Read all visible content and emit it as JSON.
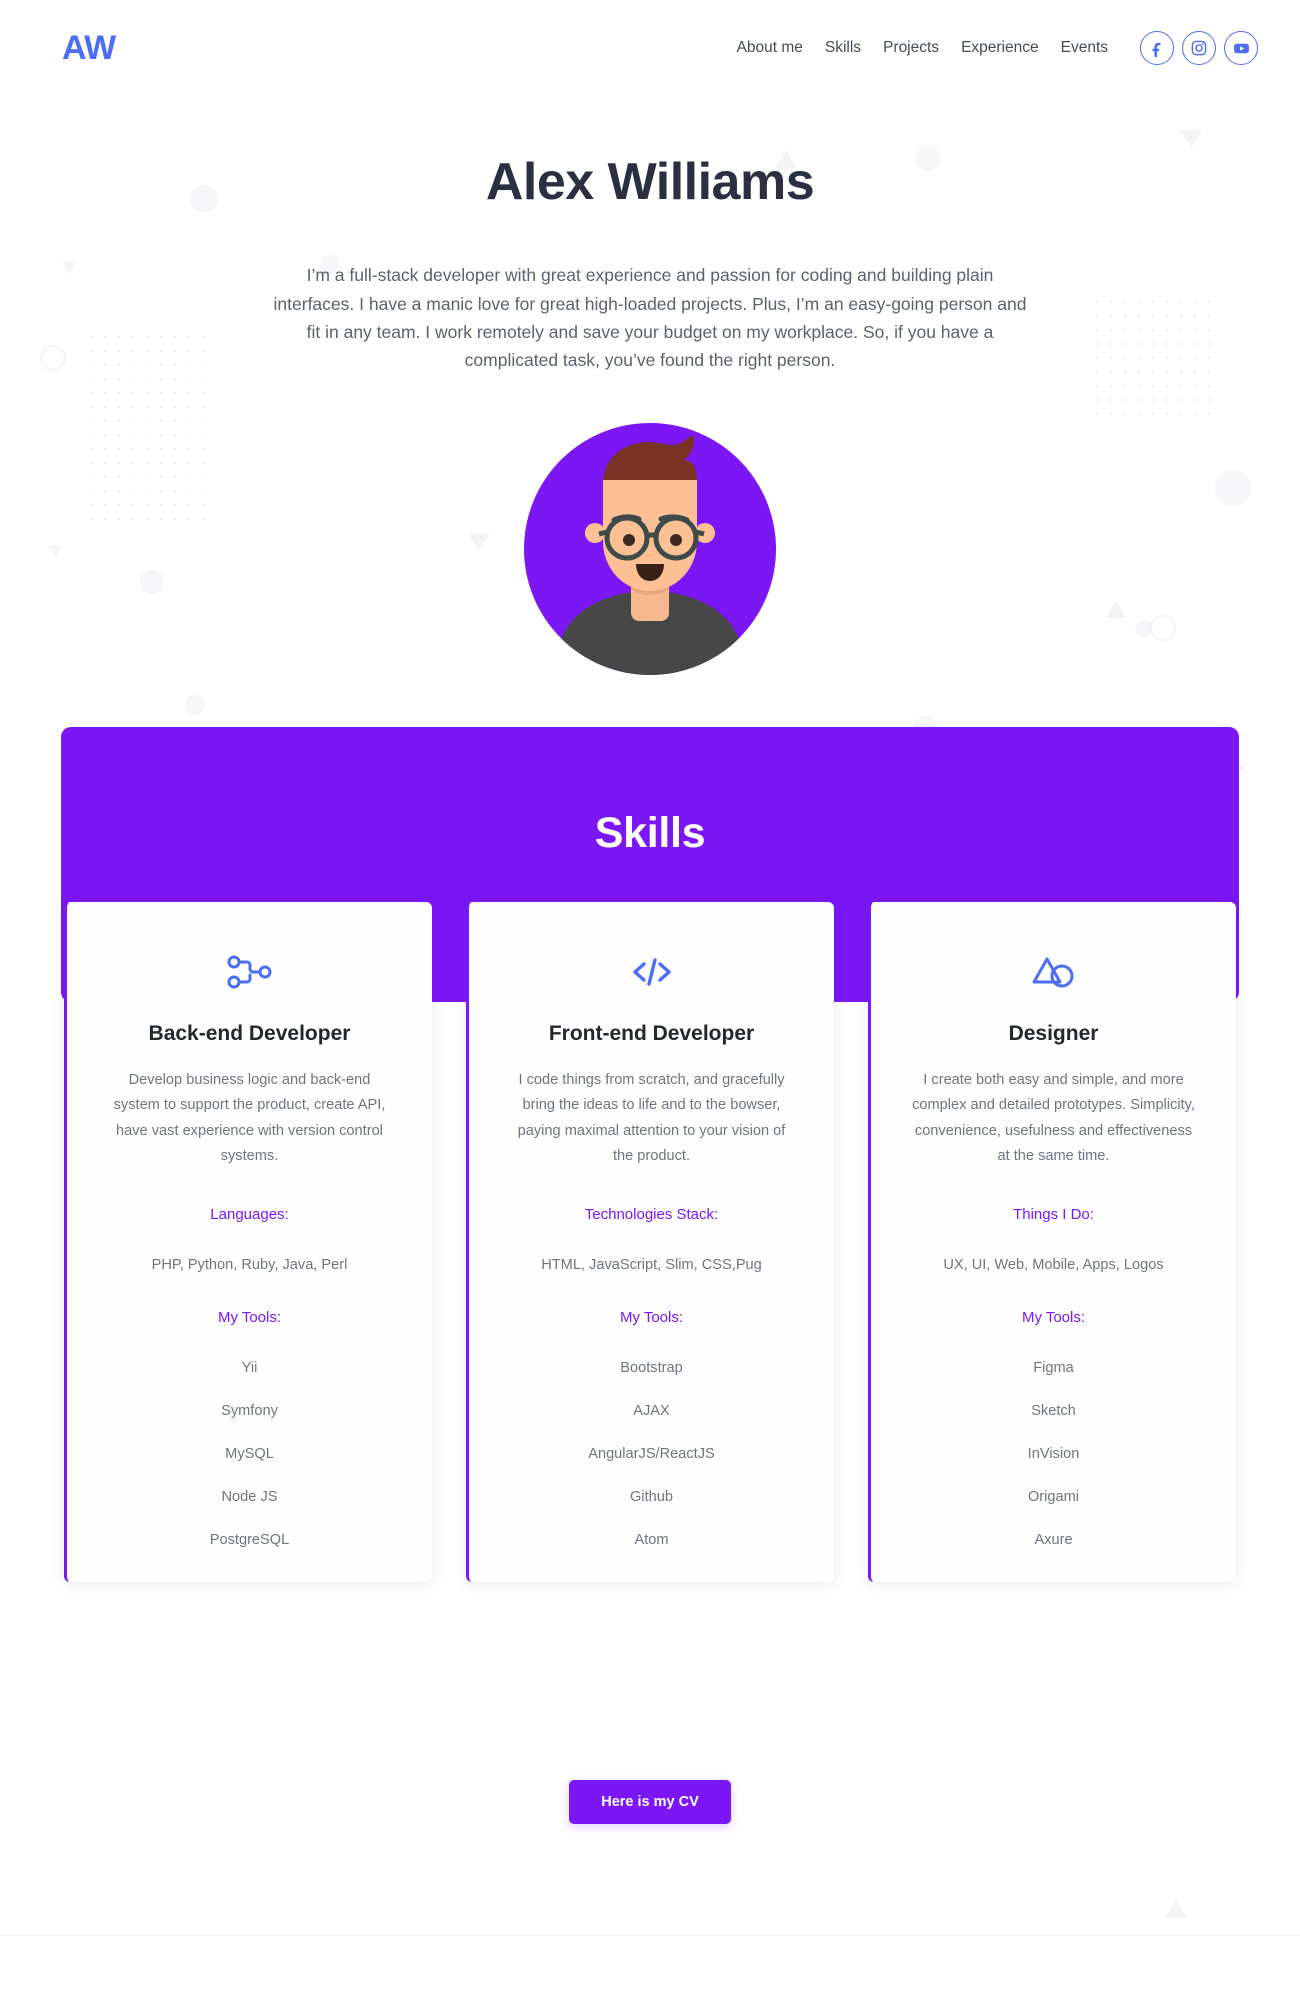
{
  "header": {
    "logo": "AW",
    "nav": [
      {
        "label": "About me",
        "name": "nav-about-me"
      },
      {
        "label": "Skills",
        "name": "nav-skills"
      },
      {
        "label": "Projects",
        "name": "nav-projects"
      },
      {
        "label": "Experience",
        "name": "nav-experience"
      },
      {
        "label": "Events",
        "name": "nav-events"
      }
    ],
    "socials": [
      {
        "icon": "facebook-icon",
        "label": "Facebook"
      },
      {
        "icon": "instagram-icon",
        "label": "Instagram"
      },
      {
        "icon": "youtube-icon",
        "label": "YouTube"
      }
    ]
  },
  "hero": {
    "title": "Alex Williams",
    "paragraph": "I’m a full-stack developer with great experience and passion for coding and building plain interfaces. I have a manic love for great high-loaded projects. Plus, I’m an easy-going person and fit in any team. I work remotely and save your budget on my workplace. So, if you have a complicated task, you’ve found the right person.",
    "avatar_name": "avatar-illustration"
  },
  "skills": {
    "heading": "Skills",
    "dots_decoration": "• • • • • • • • • • • •",
    "cards": [
      {
        "icon": "branch-nodes-icon",
        "title": "Back-end Developer",
        "description": "Develop business logic and back-end system to support the product, create API, have vast experience with version control systems.",
        "label": "Languages:",
        "value": "PHP, Python, Ruby, Java, Perl",
        "tools_label": "My Tools:",
        "tools": [
          "Yii",
          "Symfony",
          "MySQL",
          "Node JS",
          "PostgreSQL"
        ]
      },
      {
        "icon": "code-brackets-icon",
        "title": "Front-end Developer",
        "description": "I code things from scratch, and gracefully bring the ideas to life and to the bowser, paying maximal attention to your vision of the product.",
        "label": "Technologies Stack:",
        "value": "HTML, JavaScript, Slim, CSS,Pug",
        "tools_label": "My Tools:",
        "tools": [
          "Bootstrap",
          "AJAX",
          "AngularJS/ReactJS",
          "Github",
          "Atom"
        ]
      },
      {
        "icon": "shapes-triangle-circle-icon",
        "title": "Designer",
        "description": "I create both easy and simple, and more complex and detailed prototypes. Simplicity, convenience, usefulness and effectiveness at the same time.",
        "label": "Things I Do:",
        "value": "UX, UI, Web, Mobile, Apps, Logos",
        "tools_label": "My Tools:",
        "tools": [
          "Figma",
          "Sketch",
          "InVision",
          "Origami",
          "Axure"
        ]
      }
    ]
  },
  "cv": {
    "button_label": "Here is my CV"
  },
  "colors": {
    "brand_purple": "#7b16f5",
    "accent_blue": "#4c6ef5",
    "heading_dark": "#2b2f42",
    "body_gray": "#6e7480"
  }
}
